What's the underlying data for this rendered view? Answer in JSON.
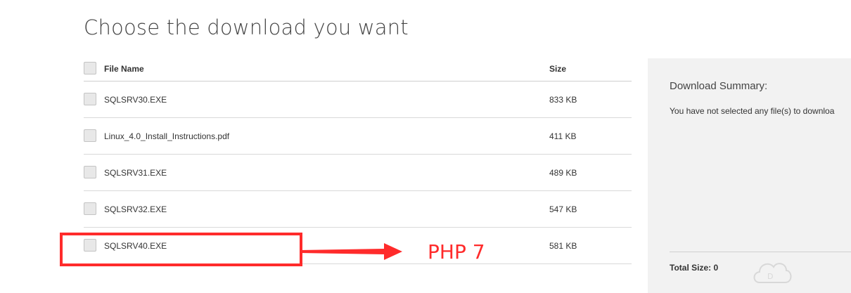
{
  "page": {
    "title": "Choose the download you want"
  },
  "table": {
    "header": {
      "name": "File Name",
      "size": "Size"
    },
    "rows": [
      {
        "name": "SQLSRV30.EXE",
        "size": "833 KB"
      },
      {
        "name": "Linux_4.0_Install_Instructions.pdf",
        "size": "411 KB"
      },
      {
        "name": "SQLSRV31.EXE",
        "size": "489 KB"
      },
      {
        "name": "SQLSRV32.EXE",
        "size": "547 KB"
      },
      {
        "name": "SQLSRV40.EXE",
        "size": "581 KB"
      }
    ]
  },
  "summary": {
    "title": "Download Summary:",
    "text": "You have not selected any file(s) to downloa",
    "total": "Total Size: 0"
  },
  "annotation": {
    "text": "PHP 7",
    "color": "#ff2b2b"
  },
  "icons": {
    "watermark": "cloud-logo-icon"
  }
}
